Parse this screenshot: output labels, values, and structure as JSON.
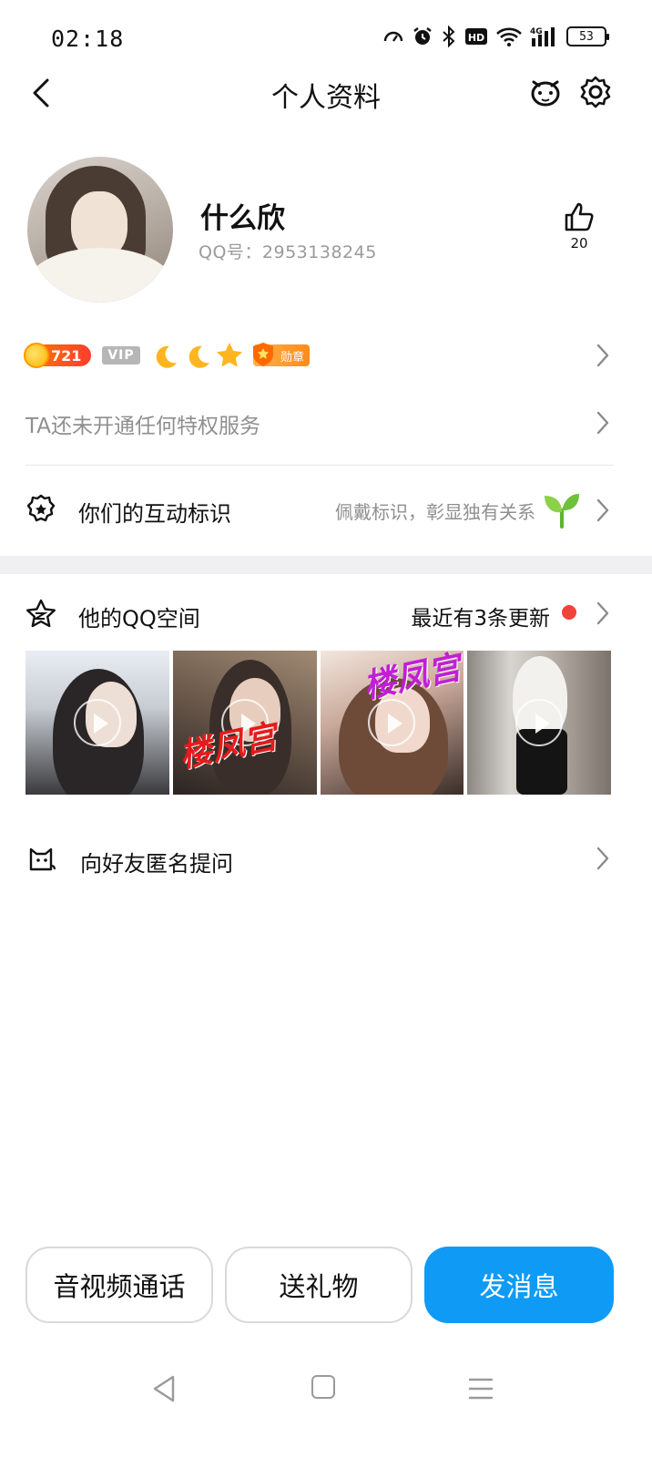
{
  "status_bar": {
    "time": "02:18",
    "battery": "53",
    "icons": [
      "speedometer-icon",
      "alarm-icon",
      "bluetooth-icon",
      "hd-icon",
      "wifi-icon",
      "signal-4g-icon"
    ]
  },
  "nav": {
    "title": "个人资料",
    "icons": [
      "back-icon",
      "pet-icon",
      "settings-gear-icon"
    ]
  },
  "profile": {
    "name": "什么欣",
    "qq_line": "QQ号：2953138245",
    "likes": "20"
  },
  "badges": {
    "level": "721",
    "vip": "VIP",
    "medal": "勋章"
  },
  "privilege": {
    "text": "TA还未开通任何特权服务"
  },
  "interaction": {
    "label": "你们的互动标识",
    "hint": "佩戴标识，彰显独有关系"
  },
  "qzone": {
    "label": "他的QQ空间",
    "update": "最近有3条更新",
    "watermark_red": "楼凤宫",
    "watermark_purple": "楼凤宫"
  },
  "ask": {
    "label": "向好友匿名提问"
  },
  "actions": {
    "call": "音视频通话",
    "gift": "送礼物",
    "message": "发消息"
  },
  "colors": {
    "accent_blue": "#0f9bf5",
    "red_dot": "#f2433b",
    "level_orange": "#ff5a1f",
    "separator_band": "#f0f0f2"
  }
}
